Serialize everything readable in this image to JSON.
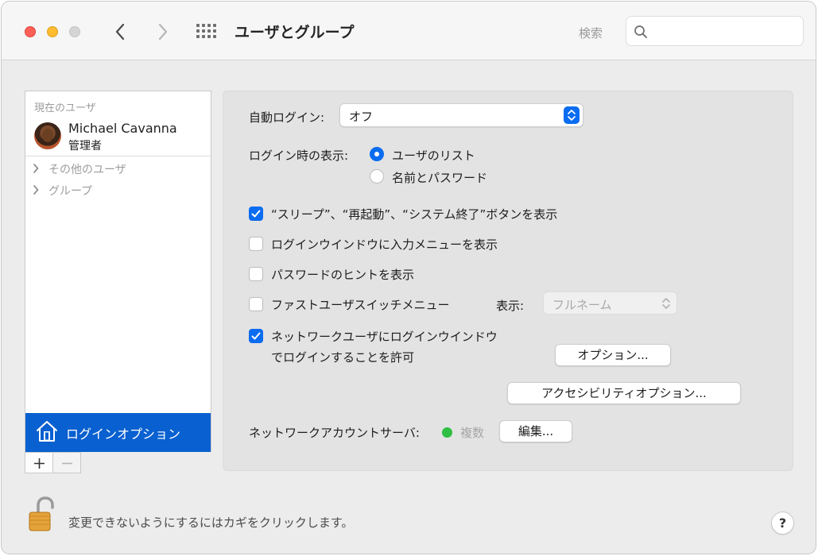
{
  "window": {
    "title": "ユーザとグループ",
    "search_label": "検索",
    "search_placeholder": ""
  },
  "sidebar": {
    "current_section": "現在のユーザ",
    "current_user": {
      "name": "Michael Cavanna",
      "role": "管理者"
    },
    "groups": [
      {
        "label": "その他のユーザ"
      },
      {
        "label": "グループ"
      }
    ],
    "selected_item": "ログインオプション",
    "add_label": "+",
    "remove_label": "−"
  },
  "panel": {
    "auto_login": {
      "label": "自動ログイン:",
      "value": "オフ"
    },
    "display_at_login": {
      "label": "ログイン時の表示:",
      "options": [
        {
          "label": "ユーザのリスト",
          "selected": true
        },
        {
          "label": "名前とパスワード",
          "selected": false
        }
      ]
    },
    "checkboxes": [
      {
        "label": "“スリープ”、“再起動”、“システム終了”ボタンを表示",
        "checked": true
      },
      {
        "label": "ログインウインドウに入力メニューを表示",
        "checked": false
      },
      {
        "label": "パスワードのヒントを表示",
        "checked": false
      },
      {
        "label": "ファストユーザスイッチメニュー",
        "checked": false
      },
      {
        "label_line1": "ネットワークユーザにログインウインドウ",
        "label_line2": "でログインすることを許可",
        "checked": true
      }
    ],
    "fast_switch_display": {
      "label": "表示:",
      "value": "フルネーム"
    },
    "options_button": "オプション...",
    "accessibility_button": "アクセシビリティオプション...",
    "network_server": {
      "label": "ネットワークアカウントサーバ:",
      "status": "複数",
      "status_color": "#2ebf43",
      "edit_button": "編集..."
    }
  },
  "footer": {
    "lock_text": "変更できないようにするにはカギをクリックします。",
    "help_label": "?"
  },
  "colors": {
    "accent": "#0a6cf0",
    "selection": "#0960d0"
  }
}
